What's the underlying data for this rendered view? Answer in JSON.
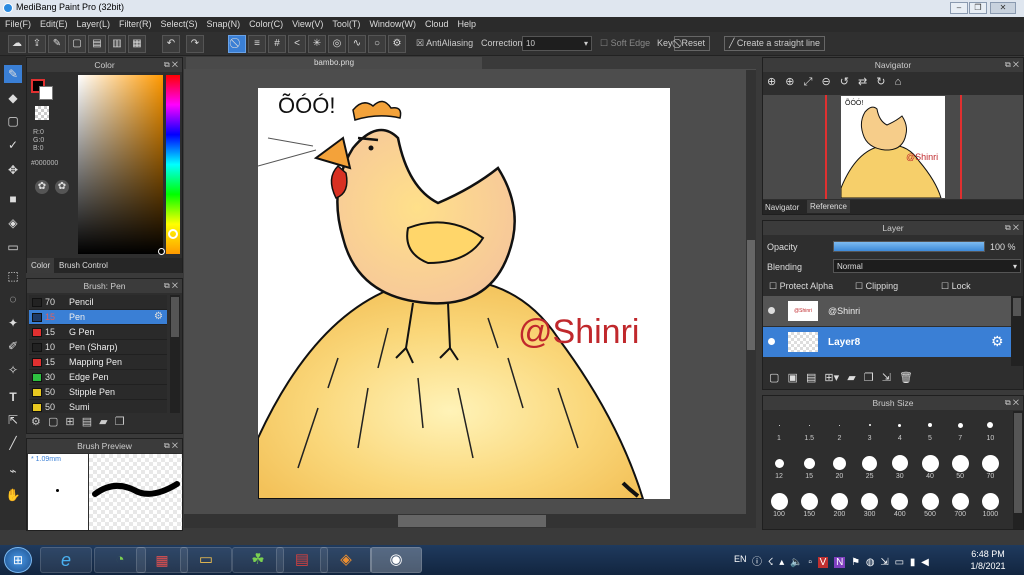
{
  "window": {
    "title": "MediBang Paint Pro (32bit)"
  },
  "menu": [
    "File(F)",
    "Edit(E)",
    "Layer(L)",
    "Filter(R)",
    "Select(S)",
    "Snap(N)",
    "Color(C)",
    "View(V)",
    "Tool(T)",
    "Window(W)",
    "Cloud",
    "Help"
  ],
  "toolbar": {
    "antialiasing": "AntiAliasing",
    "correction_label": "Correction",
    "correction_value": "10",
    "soft_edge": "Soft Edge",
    "key_label": "Key",
    "reset": "Reset",
    "straight_line": "Create a straight line"
  },
  "color_panel": {
    "title": "Color",
    "r": "R:0",
    "g": "G:0",
    "b": "B:0",
    "hex": "#000000",
    "tab_color": "Color",
    "tab_brush": "Brush Control"
  },
  "brush_panel": {
    "title": "Brush: Pen",
    "items": [
      {
        "size": "70",
        "name": "Pencil",
        "color": "#222222"
      },
      {
        "size": "15",
        "name": "Pen",
        "color": "#1e3a66"
      },
      {
        "size": "15",
        "name": "G Pen",
        "color": "#e03030"
      },
      {
        "size": "10",
        "name": "Pen (Sharp)",
        "color": "#222222"
      },
      {
        "size": "15",
        "name": "Mapping Pen",
        "color": "#e03030"
      },
      {
        "size": "30",
        "name": "Edge Pen",
        "color": "#2ec040"
      },
      {
        "size": "50",
        "name": "Stipple Pen",
        "color": "#e8c820"
      },
      {
        "size": "50",
        "name": "Sumi",
        "color": "#e8c820"
      }
    ]
  },
  "brush_preview": {
    "title": "Brush Preview",
    "size": "1.09mm"
  },
  "document": {
    "tab": "bambo.png",
    "watermark": "@Shinri",
    "exclaim": "ÕÓÓ!"
  },
  "navigator": {
    "title": "Navigator",
    "tab_nav": "Navigator",
    "tab_ref": "Reference",
    "watermark": "@Shinri",
    "exclaim": "ÕÓÓ!"
  },
  "layer_panel": {
    "title": "Layer",
    "opacity_label": "Opacity",
    "opacity_value": "100 %",
    "opacity_level": 1.0,
    "blending_label": "Blending",
    "blending_value": "Normal",
    "protect_alpha": "Protect Alpha",
    "clipping": "Clipping",
    "lock": "Lock",
    "layers": [
      {
        "name": "@Shinri",
        "thumb": "@Shinri"
      },
      {
        "name": "Layer8"
      }
    ]
  },
  "brush_size": {
    "title": "Brush Size",
    "row1": [
      "1",
      "1.5",
      "2",
      "3",
      "4",
      "5",
      "7",
      "10"
    ],
    "row2": [
      "12",
      "15",
      "20",
      "25",
      "30",
      "40",
      "50",
      "70"
    ],
    "row3": [
      "100",
      "150",
      "200",
      "300",
      "400",
      "500",
      "700",
      "1000"
    ]
  },
  "taskbar": {
    "lang": "EN",
    "time": "6:48 PM",
    "date": "1/8/2021"
  },
  "colors": {
    "accent": "#3a7fd5",
    "watermark": "#c0282c",
    "hay": "#f5d070"
  }
}
